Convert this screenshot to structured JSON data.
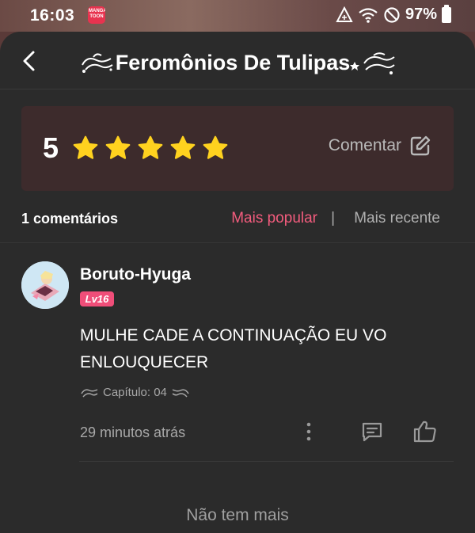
{
  "status_bar": {
    "time": "16:03",
    "app_icon_text": "MANGA TOON",
    "battery": "97%"
  },
  "header": {
    "title": "Feromônios De Tulipas"
  },
  "rating": {
    "score": "5",
    "stars": 5,
    "comment_label": "Comentar"
  },
  "sort": {
    "count_label": "1 comentários",
    "popular_label": "Mais popular",
    "separator": "|",
    "recent_label": "Mais recente"
  },
  "comment": {
    "username": "Boruto-Hyuga",
    "level": "Lv16",
    "text": "MULHE CADE A CONTINUAÇÃO EU VO ENLOUQUECER",
    "chapter_label": "Capítulo: 04",
    "time": "29 minutos atrás"
  },
  "footer": {
    "no_more": "Não tem mais"
  },
  "colors": {
    "accent_pink": "#f25c7d",
    "star_yellow": "#ffd21f",
    "card_bg": "#3d2b2c",
    "panel_bg": "#2b2b2b"
  }
}
